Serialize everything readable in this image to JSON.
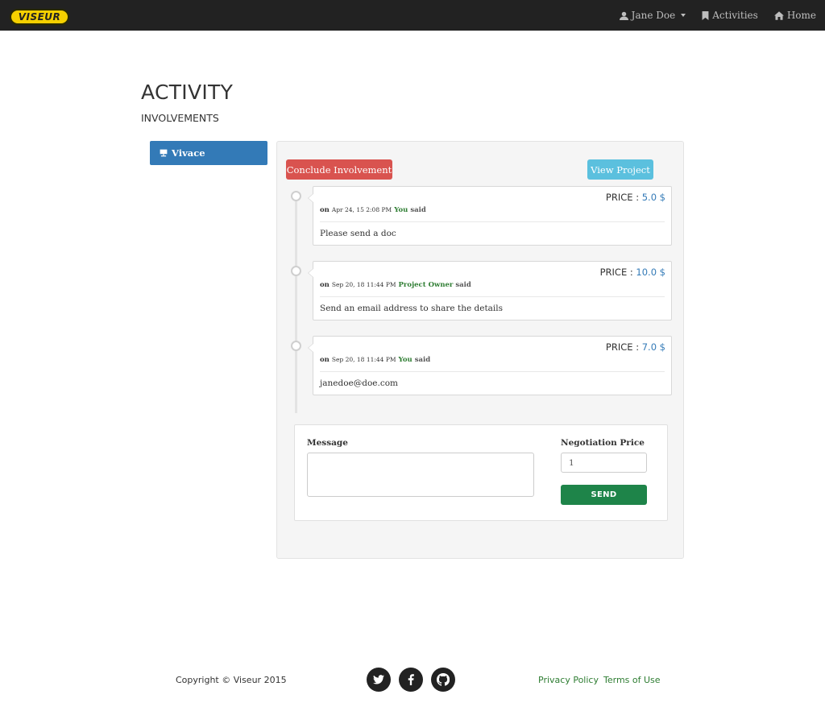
{
  "navbar": {
    "logo_text": "VISEUR",
    "user_name": "Jane Doe",
    "activities_label": "Activities",
    "home_label": "Home"
  },
  "page": {
    "title": "ACTIVITY",
    "section": "INVOLVEMENTS"
  },
  "sidebar": {
    "items": [
      {
        "label": "Vivace"
      }
    ]
  },
  "panel": {
    "conclude_label": "Conclude Involvement",
    "view_project_label": "View Project",
    "messages": [
      {
        "price_label": "PRICE :",
        "price": "5.0 $",
        "on": "on",
        "date": "Apr 24, 15 2:08 PM",
        "author": "You",
        "said": "said",
        "text": "Please send a doc"
      },
      {
        "price_label": "PRICE :",
        "price": "10.0 $",
        "on": "on",
        "date": "Sep 20, 18 11:44 PM",
        "author": "Project Owner",
        "said": "said",
        "text": "Send an email address to share the details"
      },
      {
        "price_label": "PRICE :",
        "price": "7.0 $",
        "on": "on",
        "date": "Sep 20, 18 11:44 PM",
        "author": "You",
        "said": "said",
        "text": "janedoe@doe.com"
      }
    ]
  },
  "form": {
    "message_label": "Message",
    "message_value": "",
    "price_label": "Negotiation Price",
    "price_value": "1",
    "send_label": "SEND"
  },
  "footer": {
    "copyright": "Copyright © Viseur 2015",
    "privacy_label": "Privacy Policy",
    "terms_label": "Terms of Use",
    "social_icons": [
      "twitter-icon",
      "facebook-icon",
      "github-icon"
    ]
  },
  "colors": {
    "navbar_bg": "#222222",
    "primary": "#337ab7",
    "danger": "#d9534f",
    "info": "#5bc0de",
    "success": "#1e8449",
    "logo": "#f5d000"
  }
}
